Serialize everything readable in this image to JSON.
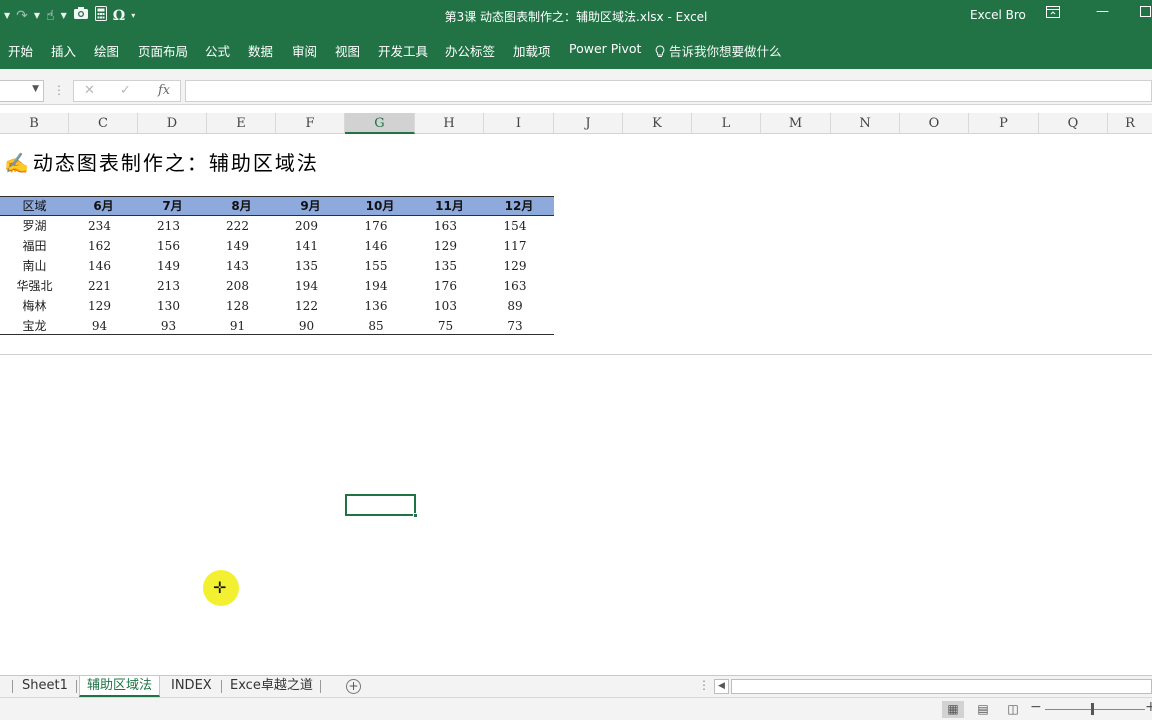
{
  "window": {
    "title": "第3课 动态图表制作之：辅助区域法.xlsx  -  Excel",
    "user": "Excel Bro",
    "qat_icons": [
      "undo-dropdown-icon",
      "redo-icon",
      "touch-mode-icon",
      "camera-icon",
      "calculator-icon",
      "omega-symbol-icon",
      "customize-qat-icon"
    ]
  },
  "ribbon": {
    "tabs": [
      "开始",
      "插入",
      "绘图",
      "页面布局",
      "公式",
      "数据",
      "审阅",
      "视图",
      "开发工具",
      "办公标签",
      "加载项",
      "Power Pivot"
    ],
    "tell_me": "告诉我你想要做什么"
  },
  "formula_bar": {
    "name_box": "",
    "formula": "",
    "fx_label": "fx"
  },
  "columns": [
    "B",
    "C",
    "D",
    "E",
    "F",
    "G",
    "H",
    "I",
    "J",
    "K",
    "L",
    "M",
    "N",
    "O",
    "P",
    "Q",
    "R"
  ],
  "selected_column": "G",
  "sheet": {
    "title": "动态图表制作之：辅助区域法",
    "table": {
      "headers": [
        "区域",
        "6月",
        "7月",
        "8月",
        "9月",
        "10月",
        "11月",
        "12月"
      ],
      "rows": [
        {
          "region": "罗湖",
          "values": [
            "234",
            "213",
            "222",
            "209",
            "176",
            "163",
            "154"
          ]
        },
        {
          "region": "福田",
          "values": [
            "162",
            "156",
            "149",
            "141",
            "146",
            "129",
            "117"
          ]
        },
        {
          "region": "南山",
          "values": [
            "146",
            "149",
            "143",
            "135",
            "155",
            "135",
            "129"
          ]
        },
        {
          "region": "华强北",
          "values": [
            "221",
            "213",
            "208",
            "194",
            "194",
            "176",
            "163"
          ]
        },
        {
          "region": "梅林",
          "values": [
            "129",
            "130",
            "128",
            "122",
            "136",
            "103",
            "89"
          ]
        },
        {
          "region": "宝龙",
          "values": [
            "94",
            "93",
            "91",
            "90",
            "85",
            "75",
            "73"
          ]
        }
      ]
    }
  },
  "sheet_tabs": {
    "tabs": [
      "Sheet1",
      "辅助区域法",
      "INDEX",
      "Exce卓越之道"
    ],
    "active": "辅助区域法"
  },
  "colors": {
    "excel_green": "#217346",
    "table_header_fill": "#8ea9db",
    "cursor_highlight": "#f3ef20"
  }
}
